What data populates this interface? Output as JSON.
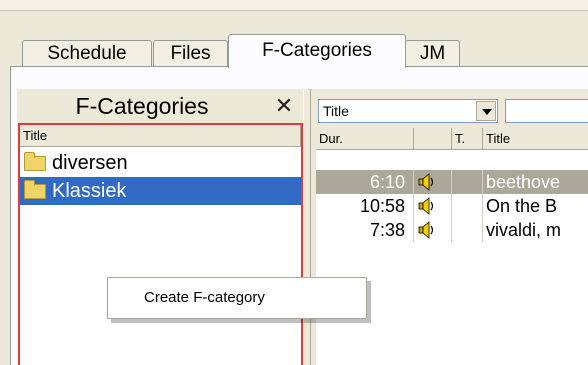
{
  "tabs": [
    {
      "label": "Schedule",
      "active": false
    },
    {
      "label": "Files",
      "active": false
    },
    {
      "label": "F-Categories",
      "active": true
    },
    {
      "label": "JM",
      "active": false
    }
  ],
  "left_panel": {
    "title": "F-Categories",
    "close_glyph": "✕",
    "column_header": "Title",
    "items": [
      {
        "label": "diversen",
        "icon": "folder-icon",
        "selected": false
      },
      {
        "label": "Klassiek",
        "icon": "folder-icon",
        "selected": true
      }
    ]
  },
  "right_panel": {
    "filter_select": {
      "value": "Title"
    },
    "search_input": {
      "value": ""
    },
    "columns": [
      "Dur.",
      "",
      "T.",
      "Title"
    ],
    "rows": [
      {
        "dur": "6:10",
        "icon": "speaker-icon",
        "t": "",
        "title": "beethove",
        "selected": true
      },
      {
        "dur": "10:58",
        "icon": "speaker-icon",
        "t": "",
        "title": "On the B",
        "selected": false
      },
      {
        "dur": "7:38",
        "icon": "speaker-icon",
        "t": "",
        "title": "vivaldi, m",
        "selected": false
      }
    ]
  },
  "context_menu": {
    "items": [
      {
        "label": "Create F-category"
      }
    ]
  },
  "colors": {
    "selection": "#316ac5",
    "inactive_selection": "#aca899",
    "focus_border": "#e03c3c",
    "face": "#ece9d8"
  }
}
